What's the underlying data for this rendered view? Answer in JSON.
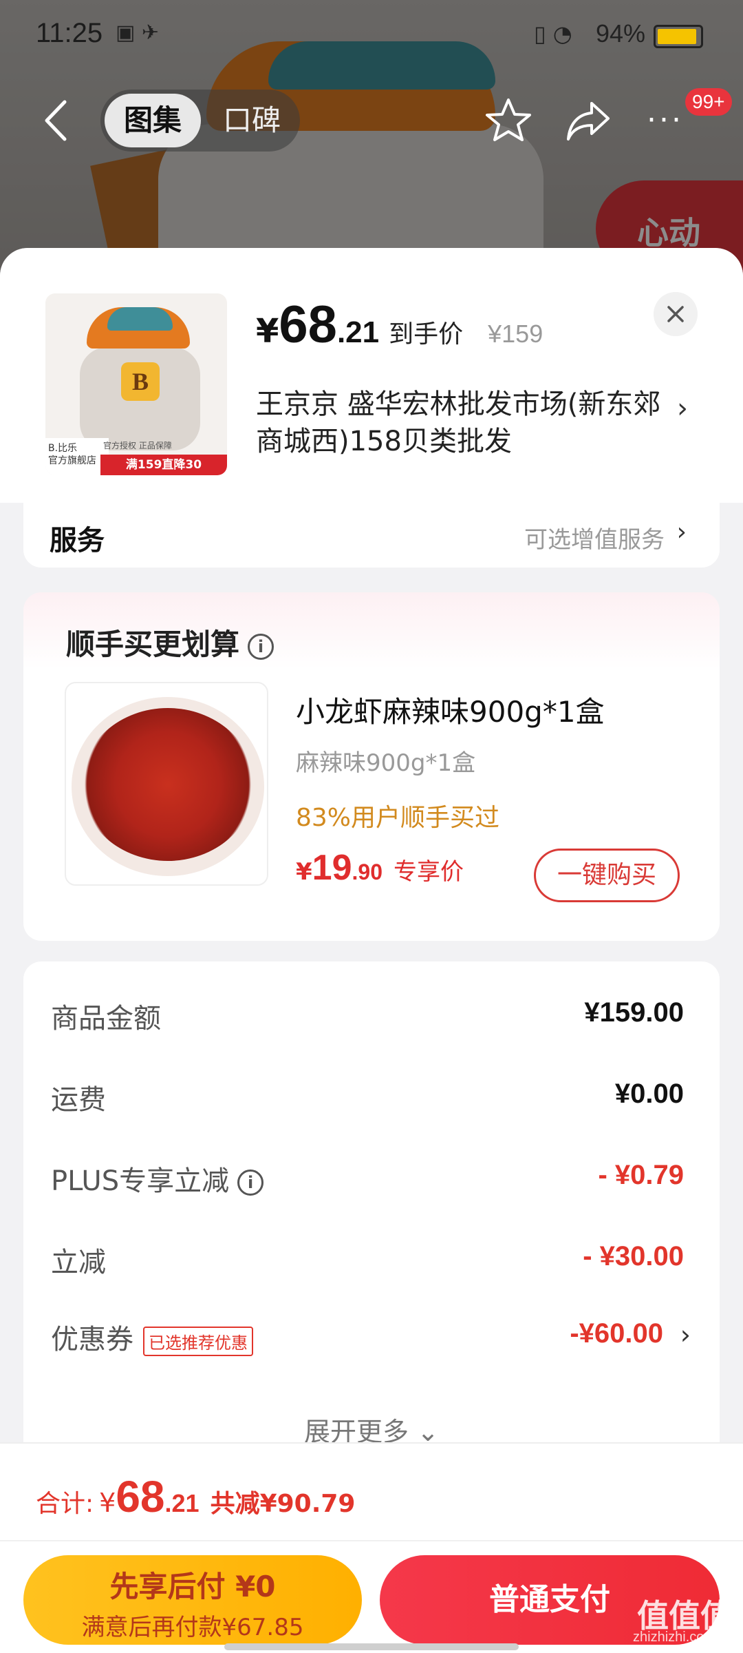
{
  "status_bar": {
    "time": "11:25",
    "battery_text": "94%",
    "battery_level": 0.94
  },
  "nav": {
    "tab_gallery": "图集",
    "tab_reviews": "口碑",
    "badge": "99+",
    "promo_tag": "心动",
    "more_glyph": "···"
  },
  "sheet": {
    "product": {
      "thumb_brand": "B.比乐\n官方旗舰店",
      "thumb_tag": "官方授权 正品保障",
      "thumb_promo": "满159直降30",
      "price_currency": "¥",
      "price_int": "68",
      "price_dec": ".21",
      "price_label": "到手价",
      "original_price": "¥159"
    },
    "address": "王京京  盛华宏林批发市场(新东郊商城西)158贝类批发",
    "service": {
      "label": "服务",
      "value": "可选增值服务"
    },
    "upsell": {
      "title": "顺手买更划算",
      "name": "小龙虾麻辣味900g*1盒",
      "spec": "麻辣味900g*1盒",
      "pct": "83%用户顺手买过",
      "price_currency": "¥",
      "price_int": "19",
      "price_dec": ".90",
      "price_label": "专享价",
      "buy_label": "一键购买"
    },
    "summary": {
      "rows": [
        {
          "label": "商品金额",
          "value": "¥159.00"
        },
        {
          "label": "运费",
          "value": "¥0.00"
        },
        {
          "label": "PLUS专享立减",
          "value": "- ¥0.79"
        },
        {
          "label": "立减",
          "value": "- ¥30.00"
        },
        {
          "label": "优惠券",
          "value": "-¥60.00",
          "chip": "已选推荐优惠"
        }
      ],
      "expand": "展开更多 ⌄"
    }
  },
  "bottom": {
    "total_label": "合计:",
    "total_currency": "¥",
    "total_int": "68",
    "total_dec": ".21",
    "total_reduce": "共减¥90.79",
    "pay_later_main": "先享后付 ¥0",
    "pay_later_sub": "满意后再付款¥67.85",
    "pay_button": "普通支付"
  },
  "watermark": {
    "main": "值值值",
    "sub": "zhizhizhi.com"
  },
  "colors": {
    "accent_red": "#e2352b",
    "gold": "#ffb000",
    "pay_red": "#ef2b35"
  }
}
